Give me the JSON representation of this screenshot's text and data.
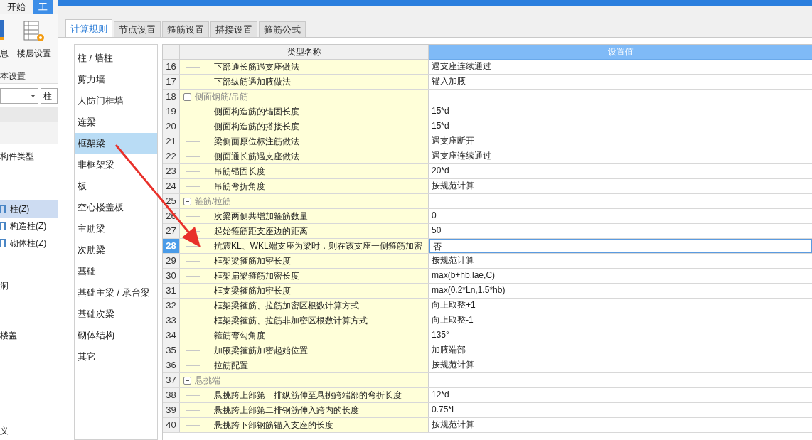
{
  "background_app": {
    "ribbon_tabs": [
      {
        "label": "开始",
        "selected": false
      },
      {
        "label": "工",
        "selected": true
      }
    ],
    "ribbon_buttons": [
      "息",
      "楼层设置"
    ],
    "ribbon_group": "本设置",
    "filter_field": {
      "value": "柱"
    },
    "tree_header": "构件类型",
    "tree_items": [
      {
        "label": "柱(Z)",
        "selected": true,
        "kind": "item"
      },
      {
        "label": "构造柱(Z)",
        "selected": false,
        "kind": "item"
      },
      {
        "label": "砌体柱(Z)",
        "selected": false,
        "kind": "item"
      },
      {
        "label": "洞",
        "selected": false,
        "kind": "category"
      },
      {
        "label": "楼盖",
        "selected": false,
        "kind": "category"
      },
      {
        "label": "义",
        "selected": false,
        "kind": "tail"
      }
    ]
  },
  "dialog": {
    "tabs": [
      {
        "label": "计算规则",
        "selected": true
      },
      {
        "label": "节点设置",
        "selected": false
      },
      {
        "label": "箍筋设置",
        "selected": false
      },
      {
        "label": "搭接设置",
        "selected": false
      },
      {
        "label": "箍筋公式",
        "selected": false
      }
    ],
    "categories": [
      {
        "label": "柱 / 墙柱",
        "selected": false
      },
      {
        "label": "剪力墙",
        "selected": false
      },
      {
        "label": "人防门框墙",
        "selected": false
      },
      {
        "label": "连梁",
        "selected": false
      },
      {
        "label": "框架梁",
        "selected": true
      },
      {
        "label": "非框架梁",
        "selected": false
      },
      {
        "label": "板",
        "selected": false
      },
      {
        "label": "空心楼盖板",
        "selected": false
      },
      {
        "label": "主肋梁",
        "selected": false
      },
      {
        "label": "次肋梁",
        "selected": false
      },
      {
        "label": "基础",
        "selected": false
      },
      {
        "label": "基础主梁 / 承台梁",
        "selected": false
      },
      {
        "label": "基础次梁",
        "selected": false
      },
      {
        "label": "砌体结构",
        "selected": false
      },
      {
        "label": "其它",
        "selected": false
      }
    ],
    "table": {
      "columns": [
        "类型名称",
        "设置值"
      ],
      "rows": [
        {
          "num": "16",
          "kind": "item",
          "name": "下部通长筋遇支座做法",
          "value": "遇支座连续通过",
          "selected": false
        },
        {
          "num": "17",
          "kind": "item",
          "name": "下部纵筋遇加腋做法",
          "value": "锚入加腋",
          "selected": false
        },
        {
          "num": "18",
          "kind": "group",
          "name": "侧面钢筋/吊筋",
          "expanded": true,
          "selected": false
        },
        {
          "num": "19",
          "kind": "item",
          "name": "侧面构造筋的锚固长度",
          "value": "15*d",
          "selected": false
        },
        {
          "num": "20",
          "kind": "item",
          "name": "侧面构造筋的搭接长度",
          "value": "15*d",
          "selected": false
        },
        {
          "num": "21",
          "kind": "item",
          "name": "梁侧面原位标注筋做法",
          "value": "遇支座断开",
          "selected": false
        },
        {
          "num": "22",
          "kind": "item",
          "name": "侧面通长筋遇支座做法",
          "value": "遇支座连续通过",
          "selected": false
        },
        {
          "num": "23",
          "kind": "item",
          "name": "吊筋锚固长度",
          "value": "20*d",
          "selected": false
        },
        {
          "num": "24",
          "kind": "item",
          "name": "吊筋弯折角度",
          "value": "按规范计算",
          "selected": false
        },
        {
          "num": "25",
          "kind": "group",
          "name": "箍筋/拉筋",
          "expanded": true,
          "selected": false
        },
        {
          "num": "26",
          "kind": "item",
          "name": "次梁两侧共增加箍筋数量",
          "value": "0",
          "selected": false
        },
        {
          "num": "27",
          "kind": "item",
          "name": "起始箍筋距支座边的距离",
          "value": "50",
          "selected": false
        },
        {
          "num": "28",
          "kind": "item",
          "name": "抗震KL、WKL端支座为梁时，则在该支座一侧箍筋加密",
          "value": "否",
          "selected": true
        },
        {
          "num": "29",
          "kind": "item",
          "name": "框架梁箍筋加密长度",
          "value": "按规范计算",
          "selected": false
        },
        {
          "num": "30",
          "kind": "item",
          "name": "框架扁梁箍筋加密长度",
          "value": "max(b+hb,lae,C)",
          "selected": false
        },
        {
          "num": "31",
          "kind": "item",
          "name": "框支梁箍筋加密长度",
          "value": "max(0.2*Ln,1.5*hb)",
          "selected": false
        },
        {
          "num": "32",
          "kind": "item",
          "name": "框架梁箍筋、拉筋加密区根数计算方式",
          "value": "向上取整+1",
          "selected": false
        },
        {
          "num": "33",
          "kind": "item",
          "name": "框架梁箍筋、拉筋非加密区根数计算方式",
          "value": "向上取整-1",
          "selected": false
        },
        {
          "num": "34",
          "kind": "item",
          "name": "箍筋弯勾角度",
          "value": "135°",
          "selected": false
        },
        {
          "num": "35",
          "kind": "item",
          "name": "加腋梁箍筋加密起始位置",
          "value": "加腋端部",
          "selected": false
        },
        {
          "num": "36",
          "kind": "item",
          "name": "拉筋配置",
          "value": "按规范计算",
          "selected": false
        },
        {
          "num": "37",
          "kind": "group",
          "name": "悬挑端",
          "expanded": true,
          "selected": false
        },
        {
          "num": "38",
          "kind": "item",
          "name": "悬挑跨上部第一排纵筋伸至悬挑跨端部的弯折长度",
          "value": "12*d",
          "selected": false
        },
        {
          "num": "39",
          "kind": "item",
          "name": "悬挑跨上部第二排钢筋伸入跨内的长度",
          "value": "0.75*L",
          "selected": false
        },
        {
          "num": "40",
          "kind": "item",
          "name": "悬挑跨下部钢筋锚入支座的长度",
          "value": "按规范计算",
          "selected": false
        }
      ]
    }
  }
}
